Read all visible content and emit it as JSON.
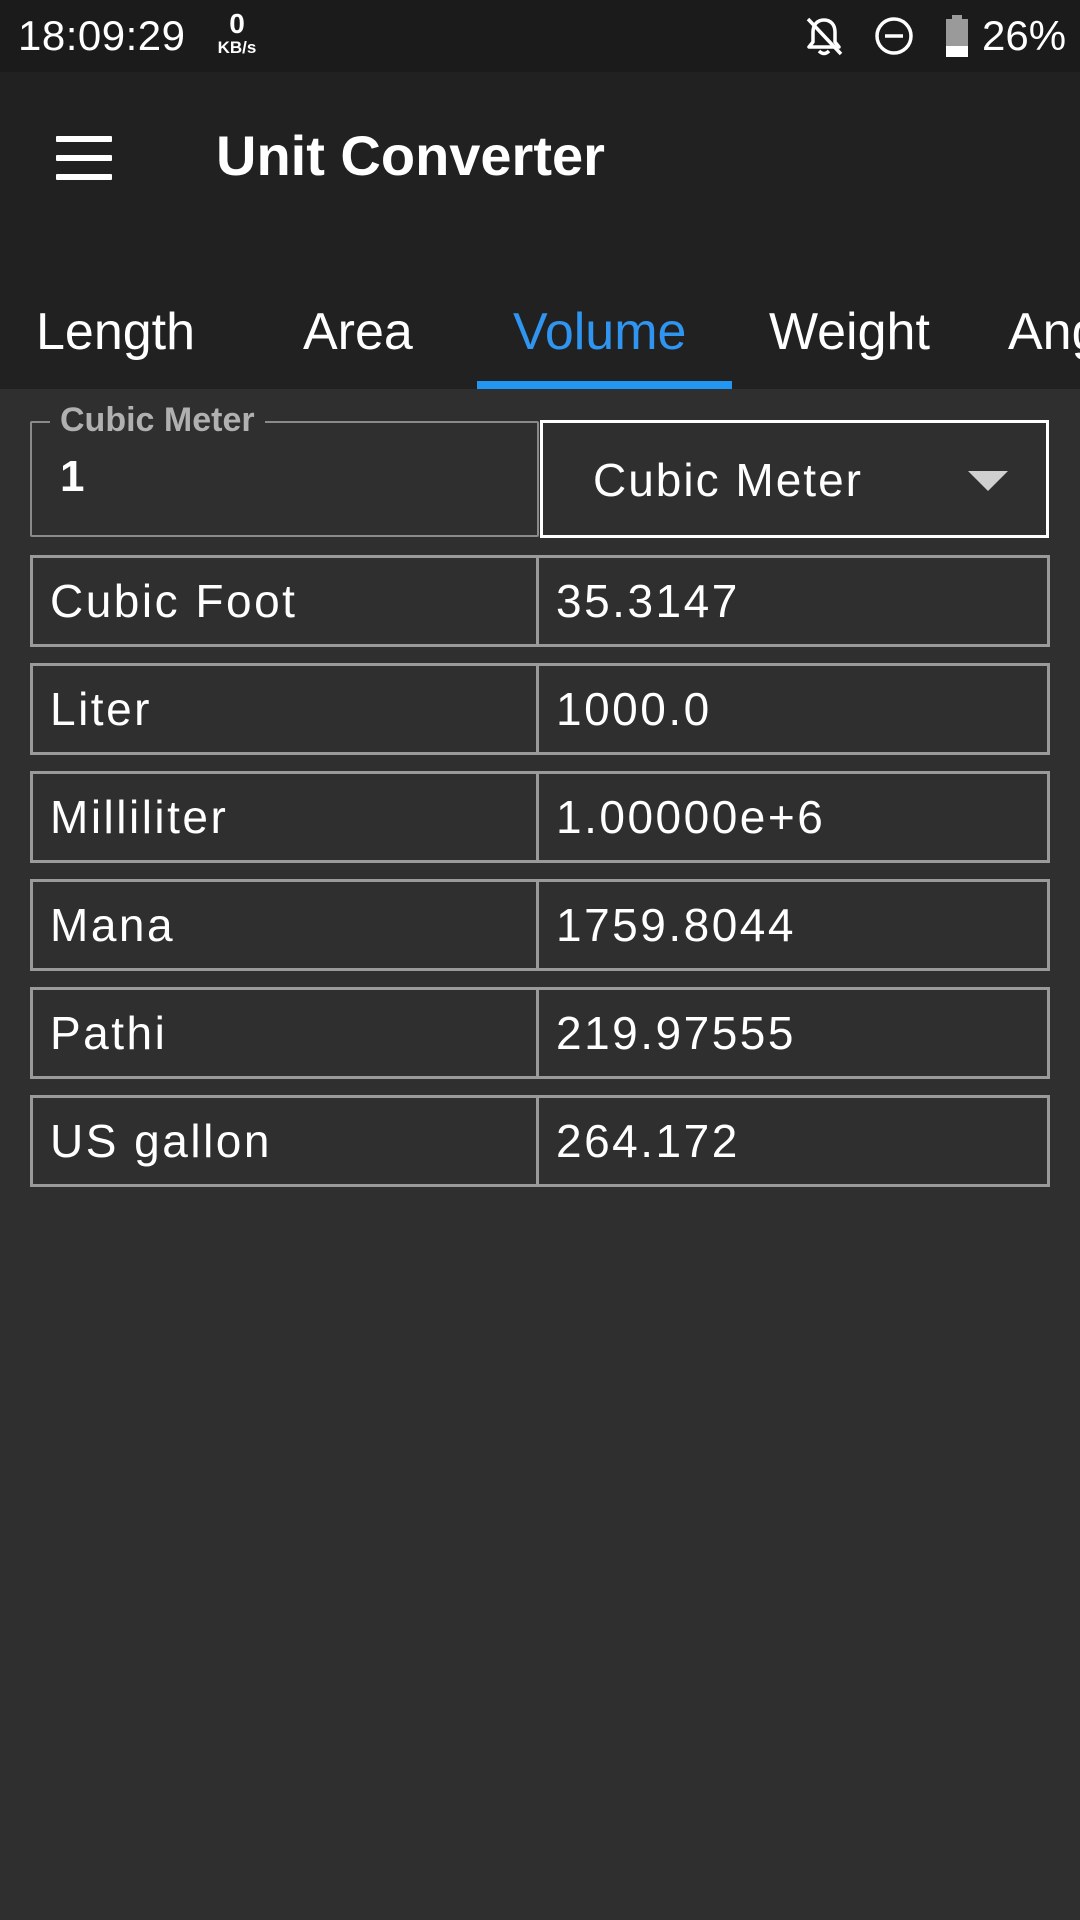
{
  "status_bar": {
    "time": "18:09:29",
    "net_speed_value": "0",
    "net_speed_unit": "KB/s",
    "battery_percent": "26%",
    "icons": [
      "bell-off-icon",
      "do-not-disturb-icon",
      "battery-icon"
    ]
  },
  "app_bar": {
    "title": "Unit Converter",
    "menu_icon": "hamburger-menu-icon"
  },
  "tabs": [
    {
      "label": "Length",
      "active": false
    },
    {
      "label": "Area",
      "active": false
    },
    {
      "label": "Volume",
      "active": true
    },
    {
      "label": "Weight",
      "active": false
    },
    {
      "label": "Ang",
      "active": false
    }
  ],
  "input": {
    "label": "Cubic Meter",
    "value": "1"
  },
  "unit_select": {
    "selected": "Cubic Meter"
  },
  "conversions": [
    {
      "unit": "Cubic Foot",
      "value": "35.3147"
    },
    {
      "unit": "Liter",
      "value": "1000.0"
    },
    {
      "unit": "Milliliter",
      "value": "1.00000e+6"
    },
    {
      "unit": "Mana",
      "value": "1759.8044"
    },
    {
      "unit": "Pathi",
      "value": "219.97555"
    },
    {
      "unit": "US gallon",
      "value": "264.172"
    }
  ],
  "colors": {
    "accent": "#2196f3",
    "background": "#2f2f2f",
    "app_bar": "#212121",
    "status_bar": "#1b1b1b"
  }
}
